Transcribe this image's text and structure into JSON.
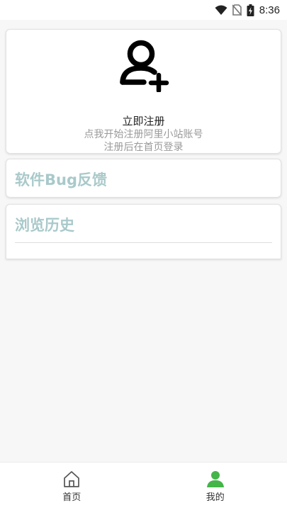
{
  "status_bar": {
    "time": "8:36",
    "icons": [
      "wifi-icon",
      "no-sim-icon",
      "battery-charging-icon"
    ]
  },
  "register": {
    "icon": "add-user-icon",
    "title": "立即注册",
    "subtitle_line1": "点我开始注册阿里小站账号",
    "subtitle_line2": "注册后在首页登录"
  },
  "bug_report": {
    "label": "软件Bug反馈"
  },
  "history": {
    "label": "浏览历史"
  },
  "bottom_nav": {
    "home_label": "首页",
    "mine_label": "我的"
  },
  "colors": {
    "accent_green": "#44b549",
    "section_title": "#a9c9ca",
    "subtitle_gray": "#9a9a9a"
  }
}
